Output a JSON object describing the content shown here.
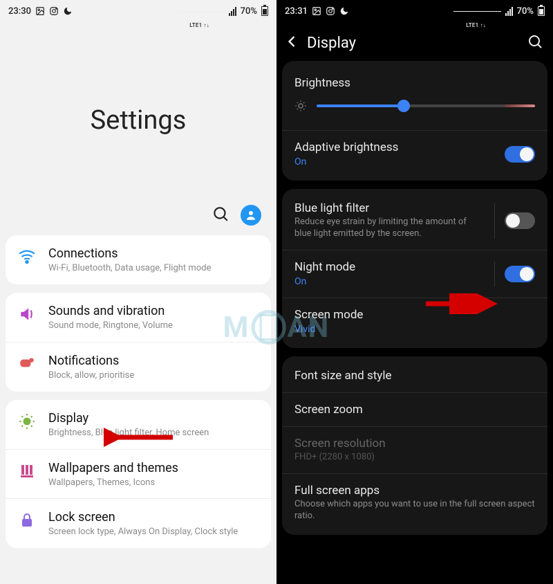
{
  "left": {
    "status": {
      "time": "23:30",
      "battery": "70%"
    },
    "title": "Settings",
    "groups": [
      {
        "items": [
          {
            "icon": "wifi",
            "title": "Connections",
            "sub": "Wi-Fi, Bluetooth, Data usage, Flight mode"
          }
        ]
      },
      {
        "items": [
          {
            "icon": "sound",
            "title": "Sounds and vibration",
            "sub": "Sound mode, Ringtone, Volume"
          },
          {
            "icon": "notif",
            "title": "Notifications",
            "sub": "Block, allow, prioritise"
          }
        ]
      },
      {
        "items": [
          {
            "icon": "display",
            "title": "Display",
            "sub": "Brightness, Blue light filter, Home screen"
          },
          {
            "icon": "wallpaper",
            "title": "Wallpapers and themes",
            "sub": "Wallpapers, Themes, Icons"
          },
          {
            "icon": "lock",
            "title": "Lock screen",
            "sub": "Screen lock type, Always On Display, Clock style"
          }
        ]
      }
    ]
  },
  "right": {
    "status": {
      "time": "23:31",
      "battery": "70%"
    },
    "title": "Display",
    "brightness_label": "Brightness",
    "adaptive": {
      "title": "Adaptive brightness",
      "sub": "On",
      "on": true
    },
    "bluelight": {
      "title": "Blue light filter",
      "sub": "Reduce eye strain by limiting the amount of blue light emitted by the screen.",
      "on": false
    },
    "night": {
      "title": "Night mode",
      "sub": "On",
      "on": true
    },
    "screenmode": {
      "title": "Screen mode",
      "sub": "Vivid"
    },
    "font": {
      "title": "Font size and style"
    },
    "zoom": {
      "title": "Screen zoom"
    },
    "resolution": {
      "title": "Screen resolution",
      "sub": "FHD+ (2280 x 1080)"
    },
    "fullscreen": {
      "title": "Full screen apps",
      "sub": "Choose which apps you want to use in the full screen aspect ratio."
    }
  },
  "watermark": "M  AN"
}
